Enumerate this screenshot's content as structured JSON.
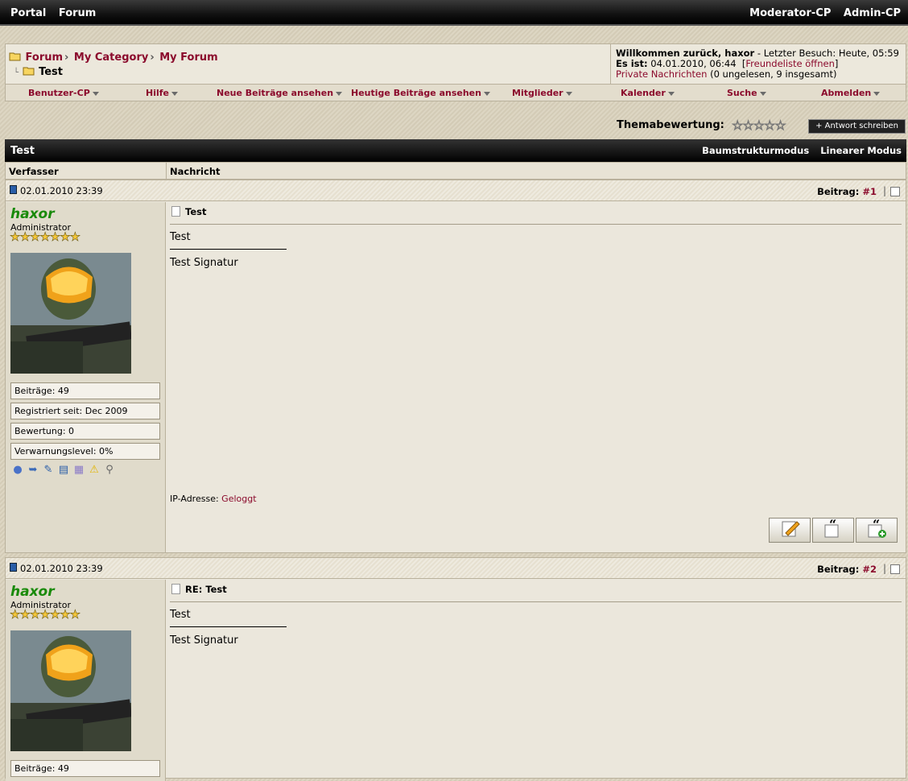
{
  "topbar": {
    "left": [
      "Portal",
      "Forum"
    ],
    "right": [
      "Moderator-CP",
      "Admin-CP"
    ]
  },
  "breadcrumb": {
    "items": [
      "Forum",
      "My Category",
      "My Forum"
    ],
    "current": "Test"
  },
  "welcome": {
    "greeting": "Willkommen zurück, haxor",
    "last_visit": "- Letzter Besuch: Heute, 05:59",
    "es_ist_label": "Es ist:",
    "now": "04.01.2010, 06:44",
    "friends_link": "Freundeliste öffnen",
    "pm_link": "Private Nachrichten",
    "pm_status": "(0 ungelesen, 9 insgesamt)"
  },
  "menu": [
    "Benutzer-CP",
    "Hilfe",
    "Neue Beiträge ansehen",
    "Heutige Beiträge ansehen",
    "Mitglieder",
    "Kalender",
    "Suche",
    "Abmelden"
  ],
  "rating": {
    "label": "Themabewertung:",
    "stars": "☆☆☆☆☆"
  },
  "reply_button": "+ Antwort schreiben",
  "thread": {
    "title": "Test",
    "modes": [
      "Baumstrukturmodus",
      "Linearer Modus"
    ]
  },
  "columns": {
    "author": "Verfasser",
    "message": "Nachricht"
  },
  "posts": [
    {
      "date": "02.01.2010 23:39",
      "post_label": "Beitrag:",
      "post_num": "#1",
      "user": "haxor",
      "rank": "Administrator",
      "stars": "★★★★★★★",
      "info": [
        "Beiträge: 49",
        "Registriert seit: Dec 2009",
        "Bewertung: 0",
        "Verwarnungslevel: 0%"
      ],
      "subject": "Test",
      "body": "Test",
      "signature": "Test Signatur",
      "ip_label": "IP-Adresse:",
      "ip_value": "Geloggt"
    },
    {
      "date": "02.01.2010 23:39",
      "post_label": "Beitrag:",
      "post_num": "#2",
      "user": "haxor",
      "rank": "Administrator",
      "stars": "★★★★★★★",
      "info": [
        "Beiträge: 49"
      ],
      "subject": "RE: Test",
      "body": "Test",
      "signature": "Test Signatur"
    }
  ],
  "colors": {
    "accent": "#8b0a2c",
    "username": "#198a0a"
  }
}
